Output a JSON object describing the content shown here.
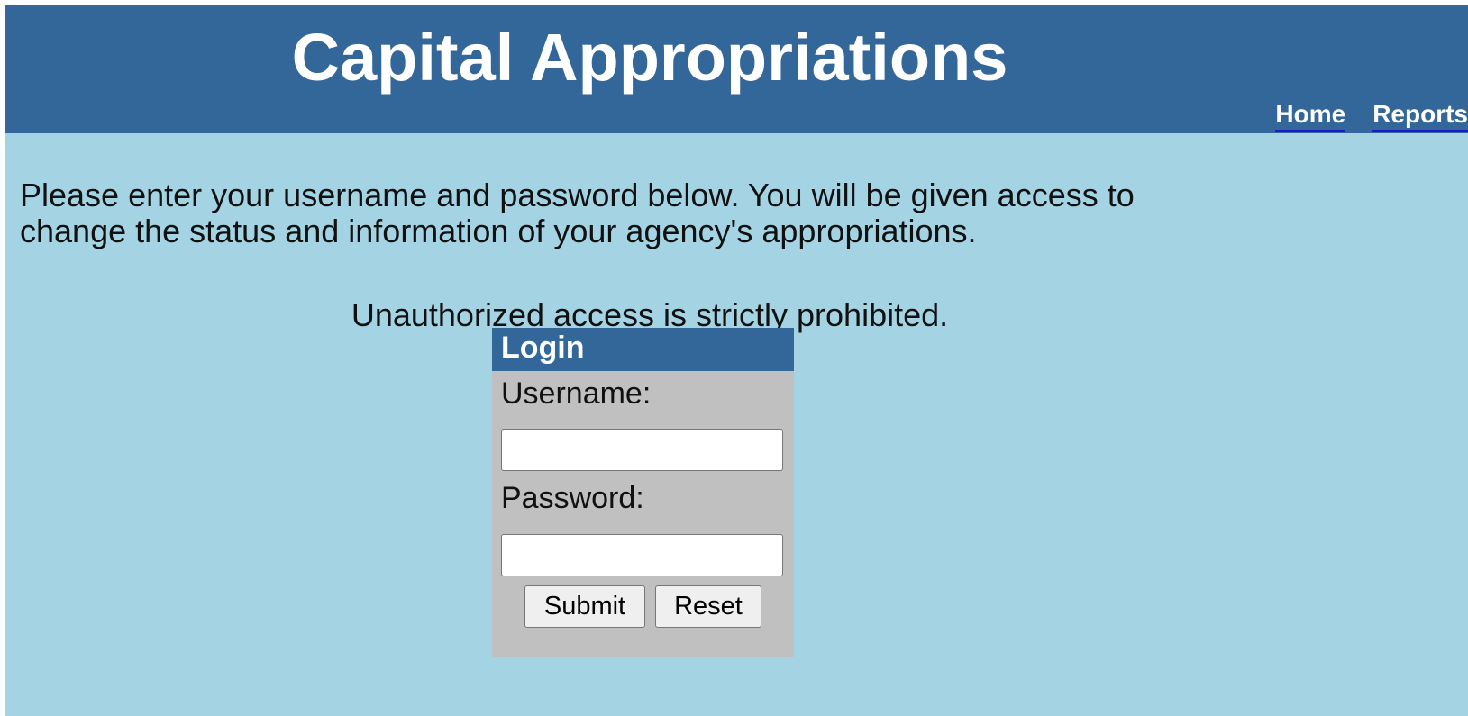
{
  "header": {
    "title": "Capital Appropriations",
    "nav": [
      {
        "label": "Home"
      },
      {
        "label": "Reports"
      }
    ]
  },
  "intro": {
    "text": "Please enter your username and password below. You will be given access to change the status and information of your agency's appropriations."
  },
  "warning": {
    "text": "Unauthorized access is strictly prohibited."
  },
  "login": {
    "title": "Login",
    "username_label": "Username:",
    "username_value": "",
    "password_label": "Password:",
    "password_value": "",
    "submit_label": "Submit",
    "reset_label": "Reset"
  },
  "colors": {
    "header_bg": "#336699",
    "page_bg": "#a4d4e4",
    "login_bg": "#c0c0c0"
  }
}
